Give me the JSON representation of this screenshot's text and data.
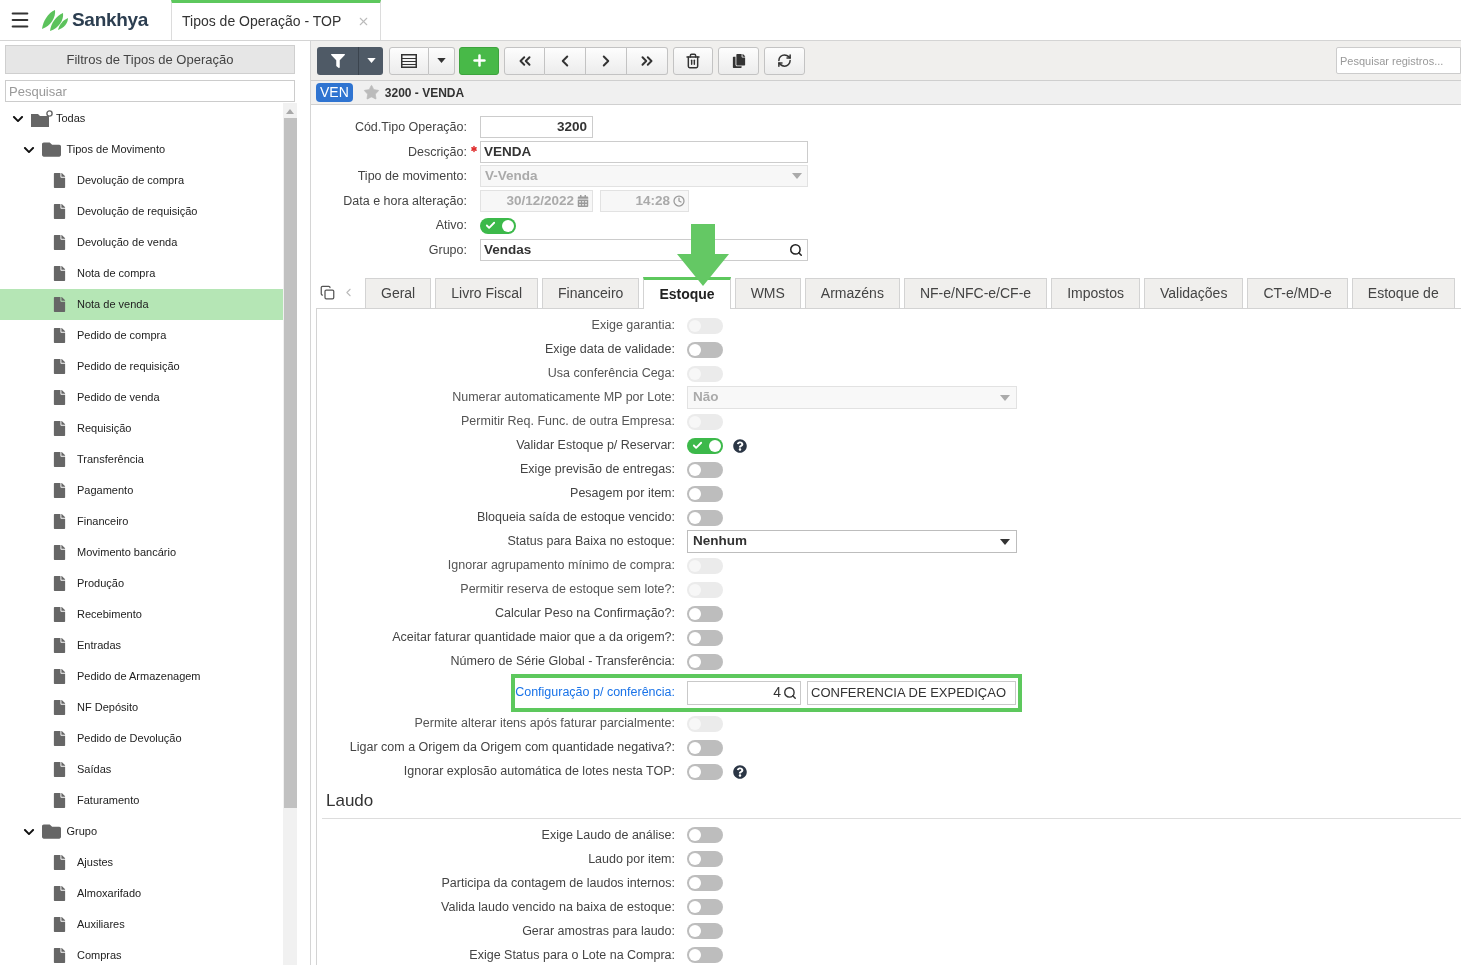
{
  "topbar": {
    "logo": "Sankhya",
    "tabs": [
      {
        "label": "Tipos de Operação - TOP",
        "selected": true
      }
    ]
  },
  "sidebar": {
    "title": "Filtros de Tipos de Operação",
    "search": {
      "placeholder": "Pesquisar"
    },
    "tree": [
      {
        "label": "Todas",
        "kind": "root",
        "expanded": true,
        "selected": false,
        "children": [
          {
            "label": "Tipos de Movimento",
            "kind": "folder",
            "expanded": true,
            "selected": false,
            "children": [
              {
                "label": "Devolução de compra",
                "kind": "item",
                "selected": false
              },
              {
                "label": "Devolução de requisição",
                "kind": "item",
                "selected": false
              },
              {
                "label": "Devolução de venda",
                "kind": "item",
                "selected": false
              },
              {
                "label": "Nota de compra",
                "kind": "item",
                "selected": false
              },
              {
                "label": "Nota de venda",
                "kind": "item",
                "selected": true
              },
              {
                "label": "Pedido de compra",
                "kind": "item",
                "selected": false
              },
              {
                "label": "Pedido de requisição",
                "kind": "item",
                "selected": false
              },
              {
                "label": "Pedido de venda",
                "kind": "item",
                "selected": false
              },
              {
                "label": "Requisição",
                "kind": "item",
                "selected": false
              },
              {
                "label": "Transferência",
                "kind": "item",
                "selected": false
              },
              {
                "label": "Pagamento",
                "kind": "item",
                "selected": false
              },
              {
                "label": "Financeiro",
                "kind": "item",
                "selected": false
              },
              {
                "label": "Movimento bancário",
                "kind": "item",
                "selected": false
              },
              {
                "label": "Produção",
                "kind": "item",
                "selected": false
              },
              {
                "label": "Recebimento",
                "kind": "item",
                "selected": false
              },
              {
                "label": "Entradas",
                "kind": "item",
                "selected": false
              },
              {
                "label": "Pedido de Armazenagem",
                "kind": "item",
                "selected": false
              },
              {
                "label": "NF Depósito",
                "kind": "item",
                "selected": false
              },
              {
                "label": "Pedido de Devolução",
                "kind": "item",
                "selected": false
              },
              {
                "label": "Saídas",
                "kind": "item",
                "selected": false
              },
              {
                "label": "Faturamento",
                "kind": "item",
                "selected": false
              }
            ]
          },
          {
            "label": "Grupo",
            "kind": "folder",
            "expanded": true,
            "selected": false,
            "children": [
              {
                "label": "Ajustes",
                "kind": "item",
                "selected": false
              },
              {
                "label": "Almoxarifado",
                "kind": "item",
                "selected": false
              },
              {
                "label": "Auxiliares",
                "kind": "item",
                "selected": false
              },
              {
                "label": "Compras",
                "kind": "item",
                "selected": false
              }
            ]
          }
        ]
      }
    ]
  },
  "toolbar": {
    "search": {
      "placeholder": "Pesquisar registros..."
    }
  },
  "record": {
    "badge": "VEN",
    "favorite": false,
    "title": "3200 - VENDA"
  },
  "form": {
    "fields": [
      {
        "kind": "number",
        "label": "Cód.Tipo Operação:",
        "value": "3200",
        "required": false,
        "disabled": false
      },
      {
        "kind": "text",
        "label": "Descrição:",
        "value": "VENDA",
        "required": true,
        "disabled": false
      },
      {
        "kind": "select",
        "label": "Tipo de movimento:",
        "value": "V-Venda",
        "required": false,
        "disabled": true
      },
      {
        "kind": "datetime",
        "label": "Data e hora alteração:",
        "date": "30/12/2022",
        "time": "14:28",
        "required": false,
        "disabled": true
      },
      {
        "kind": "toggle",
        "label": "Ativo:",
        "on": true,
        "required": false,
        "disabled": false
      },
      {
        "kind": "lookup",
        "label": "Grupo:",
        "value": "Vendas",
        "required": false,
        "disabled": false
      }
    ]
  },
  "selected_tab_arrow": true,
  "tabs": [
    {
      "label": "Geral",
      "selected": false
    },
    {
      "label": "Livro Fiscal",
      "selected": false
    },
    {
      "label": "Financeiro",
      "selected": false
    },
    {
      "label": "Estoque",
      "selected": true
    },
    {
      "label": "WMS",
      "selected": false
    },
    {
      "label": "Armazéns",
      "selected": false
    },
    {
      "label": "NF-e/NFC-e/CF-e",
      "selected": false
    },
    {
      "label": "Impostos",
      "selected": false
    },
    {
      "label": "Validações",
      "selected": false
    },
    {
      "label": "CT-e/MD-e",
      "selected": false
    },
    {
      "label": "Estoque de",
      "selected": false
    }
  ],
  "estoque": {
    "rows": [
      {
        "kind": "toggle",
        "label": "Exige garantia:",
        "on": false,
        "disabled": true,
        "help": false,
        "highlighted": false
      },
      {
        "kind": "toggle",
        "label": "Exige data de validade:",
        "on": false,
        "disabled": false,
        "help": false,
        "highlighted": false
      },
      {
        "kind": "toggle",
        "label": "Usa conferência Cega:",
        "on": false,
        "disabled": true,
        "help": false,
        "highlighted": false
      },
      {
        "kind": "select",
        "label": "Numerar automaticamente MP por Lote:",
        "value": "Não",
        "disabled": true,
        "help": false,
        "highlighted": false
      },
      {
        "kind": "toggle",
        "label": "Permitir Req. Func. de outra Empresa:",
        "on": false,
        "disabled": true,
        "help": false,
        "highlighted": false
      },
      {
        "kind": "toggle",
        "label": "Validar Estoque p/ Reservar:",
        "on": true,
        "disabled": false,
        "help": true,
        "highlighted": false
      },
      {
        "kind": "toggle",
        "label": "Exige previsão de entregas:",
        "on": false,
        "disabled": false,
        "help": false,
        "highlighted": false
      },
      {
        "kind": "toggle",
        "label": "Pesagem por item:",
        "on": false,
        "disabled": false,
        "help": false,
        "highlighted": false
      },
      {
        "kind": "toggle",
        "label": "Bloqueia saída de estoque vencido:",
        "on": false,
        "disabled": false,
        "help": false,
        "highlighted": false
      },
      {
        "kind": "select",
        "label": "Status para Baixa no estoque:",
        "value": "Nenhum",
        "disabled": false,
        "help": false,
        "highlighted": false
      },
      {
        "kind": "toggle",
        "label": "Ignorar agrupamento mínimo de compra:",
        "on": false,
        "disabled": true,
        "help": false,
        "highlighted": false
      },
      {
        "kind": "toggle",
        "label": "Permitir reserva de estoque sem lote?:",
        "on": false,
        "disabled": true,
        "help": false,
        "highlighted": false
      },
      {
        "kind": "toggle",
        "label": "Calcular Peso na Confirmação?:",
        "on": false,
        "disabled": false,
        "help": false,
        "highlighted": false
      },
      {
        "kind": "toggle",
        "label": "Aceitar faturar quantidade maior que a da origem?:",
        "on": false,
        "disabled": false,
        "help": false,
        "highlighted": false
      },
      {
        "kind": "toggle",
        "label": "Número de Série Global - Transferência:",
        "on": false,
        "disabled": false,
        "help": false,
        "highlighted": false
      },
      {
        "kind": "lookup",
        "label": "Configuração p/ conferência:",
        "code": "4",
        "description": "CONFERENCIA DE EXPEDIÇAO",
        "disabled": false,
        "help": false,
        "highlighted": true
      },
      {
        "kind": "toggle",
        "label": "Permite alterar itens após faturar parcialmente:",
        "on": false,
        "disabled": true,
        "help": false,
        "highlighted": false
      },
      {
        "kind": "toggle",
        "label": "Ligar com a Origem da Origem com quantidade negativa?:",
        "on": false,
        "disabled": false,
        "help": false,
        "highlighted": false
      },
      {
        "kind": "toggle",
        "label": "Ignorar explosão automática de lotes nesta TOP:",
        "on": false,
        "disabled": false,
        "help": true,
        "highlighted": false
      }
    ]
  },
  "laudo": {
    "title": "Laudo",
    "rows": [
      {
        "kind": "toggle",
        "label": "Exige Laudo de análise:",
        "on": false,
        "disabled": false,
        "help": false,
        "highlighted": false
      },
      {
        "kind": "toggle",
        "label": "Laudo por item:",
        "on": false,
        "disabled": false,
        "help": false,
        "highlighted": false
      },
      {
        "kind": "toggle",
        "label": "Participa da contagem de laudos internos:",
        "on": false,
        "disabled": false,
        "help": false,
        "highlighted": false
      },
      {
        "kind": "toggle",
        "label": "Valida laudo vencido na baixa de estoque:",
        "on": false,
        "disabled": false,
        "help": false,
        "highlighted": false
      },
      {
        "kind": "toggle",
        "label": "Gerar amostras para laudo:",
        "on": false,
        "disabled": false,
        "help": false,
        "highlighted": false
      },
      {
        "kind": "toggle",
        "label": "Exige Status para o Lote na Compra:",
        "on": false,
        "disabled": false,
        "help": false,
        "highlighted": false
      }
    ]
  }
}
